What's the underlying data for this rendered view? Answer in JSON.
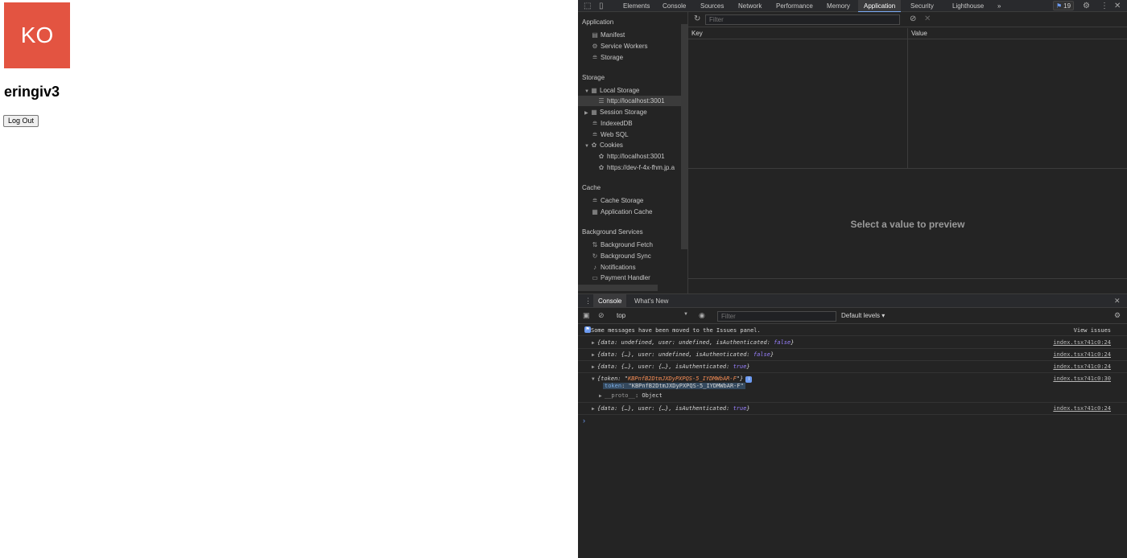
{
  "page": {
    "avatar_initials": "KO",
    "avatar_color": "#e35441",
    "username": "eringiv3",
    "logout_label": "Log Out"
  },
  "devtools": {
    "tabs": [
      "Elements",
      "Console",
      "Sources",
      "Network",
      "Performance",
      "Memory",
      "Application",
      "Security",
      "Lighthouse"
    ],
    "active_tab": "Application",
    "more_tabs": "»",
    "issues_count": "19",
    "sidebar": {
      "application_heading": "Application",
      "application_items": [
        "Manifest",
        "Service Workers",
        "Storage"
      ],
      "storage_heading": "Storage",
      "local_storage": "Local Storage",
      "local_storage_child": "http://localhost:3001",
      "session_storage": "Session Storage",
      "indexeddb": "IndexedDB",
      "websql": "Web SQL",
      "cookies": "Cookies",
      "cookie_children": [
        "http://localhost:3001",
        "https://dev-f-4x-fhm.jp.a"
      ],
      "cache_heading": "Cache",
      "cache_items": [
        "Cache Storage",
        "Application Cache"
      ],
      "bg_heading": "Background Services",
      "bg_items": [
        "Background Fetch",
        "Background Sync",
        "Notifications",
        "Payment Handler"
      ]
    },
    "storage_panel": {
      "filter_placeholder": "Filter",
      "col_key": "Key",
      "col_value": "Value",
      "preview_text": "Select a value to preview"
    },
    "drawer": {
      "tabs": [
        "Console",
        "What's New"
      ],
      "active_tab": "Console",
      "context": "top",
      "filter_placeholder": "Filter",
      "levels": "Default levels ▾",
      "issues_message": "Some messages have been moved to the Issues panel.",
      "view_issues": "View issues",
      "messages": [
        {
          "source": "index.tsx?41c0:24"
        },
        {
          "source": "index.tsx?41c0:24"
        },
        {
          "source": "index.tsx?41c0:24"
        },
        {
          "source": "index.tsx?41c0:30",
          "token_value": "KBPnfB2DtmJXDyPXPQS-5_IYDMWbAR-F",
          "token_expanded": "\"KBPnfB2DtmJXDyPXPQS-5_IYDMWbAR-F\"",
          "proto_label": "__proto__",
          "proto_value": "Object"
        },
        {
          "source": "index.tsx?41c0:24"
        }
      ]
    }
  }
}
